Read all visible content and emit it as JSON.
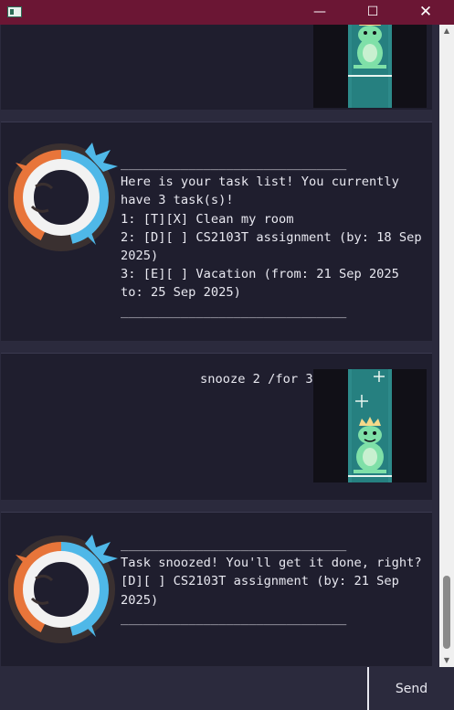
{
  "window": {
    "minimize_glyph": "—",
    "maximize_glyph": "☐",
    "close_glyph": "✕"
  },
  "messages": [
    {
      "sender": "user",
      "text": ""
    },
    {
      "sender": "bot",
      "text": "______________________________\nHere is your task list! You currently\nhave 3 task(s)!\n1: [T][X] Clean my room\n2: [D][ ] CS2103T assignment (by: 18 Sep\n2025)\n3: [E][ ] Vacation (from: 21 Sep 2025\nto: 25 Sep 2025)\n______________________________"
    },
    {
      "sender": "user",
      "text": "snooze 2 /for 3"
    },
    {
      "sender": "bot",
      "text": "______________________________\nTask snoozed! You'll get it done, right?\n[D][ ] CS2103T assignment (by: 21 Sep\n2025)\n______________________________"
    }
  ],
  "input": {
    "value": "",
    "placeholder": ""
  },
  "send_button": {
    "label": "Send"
  },
  "scrollbar": {
    "up_glyph": "▲",
    "down_glyph": "▼",
    "position": 0.95
  },
  "colors": {
    "title_bar": "#6b1634",
    "chat_background": "#2b2a3d",
    "message_background": "#1f1e2e",
    "text": "#e8e8f0",
    "avatar_orange": "#e8753a",
    "avatar_blue": "#4fb8e8",
    "portrait_teal": "#2d8a8a"
  },
  "icons": {
    "app": "app-window-icon",
    "bot_avatar": "swirl-logo-avatar",
    "user_avatar": "frog-king-portrait"
  }
}
